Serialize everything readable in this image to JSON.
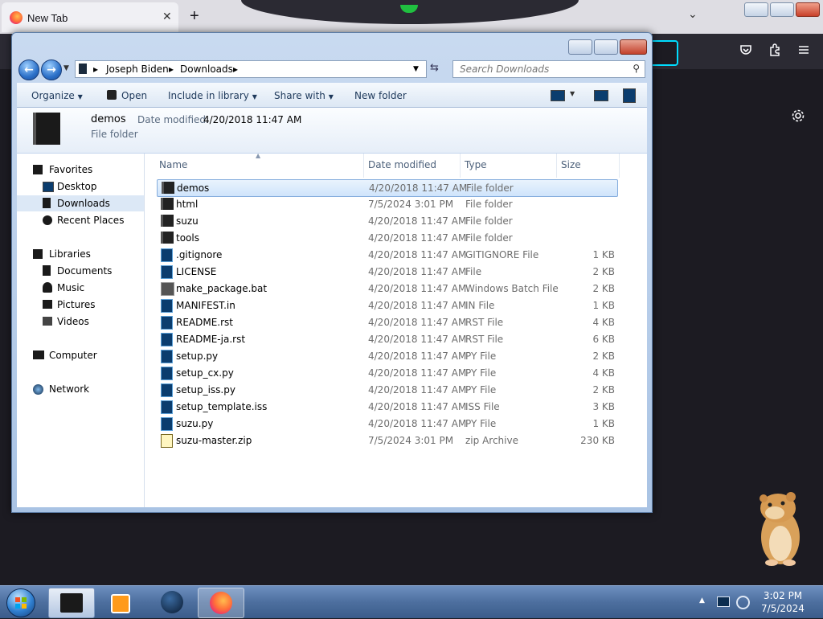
{
  "browser": {
    "tab_title": "New Tab",
    "tab_close": "✕",
    "new_tab": "+",
    "list_tabs": "⌄"
  },
  "explorer": {
    "breadcrumb": [
      "Joseph Biden",
      "Downloads"
    ],
    "search_placeholder": "Search Downloads",
    "commands": {
      "organize": "Organize",
      "open": "Open",
      "include_in_library": "Include in library",
      "share_with": "Share with",
      "new_folder": "New folder"
    },
    "details": {
      "name": "demos",
      "modified_label": "Date modified:",
      "modified_value": "4/20/2018 11:47 AM",
      "kind": "File folder"
    },
    "nav": {
      "favorites": "Favorites",
      "desktop": "Desktop",
      "downloads": "Downloads",
      "recent_places": "Recent Places",
      "libraries": "Libraries",
      "documents": "Documents",
      "music": "Music",
      "pictures": "Pictures",
      "videos": "Videos",
      "computer": "Computer",
      "network": "Network"
    },
    "columns": {
      "name": "Name",
      "date": "Date modified",
      "type": "Type",
      "size": "Size"
    },
    "files": [
      {
        "name": "demos",
        "date": "4/20/2018 11:47 AM",
        "type": "File folder",
        "size": "",
        "icon": "folder"
      },
      {
        "name": "html",
        "date": "7/5/2024 3:01 PM",
        "type": "File folder",
        "size": "",
        "icon": "folder"
      },
      {
        "name": "suzu",
        "date": "4/20/2018 11:47 AM",
        "type": "File folder",
        "size": "",
        "icon": "folder"
      },
      {
        "name": "tools",
        "date": "4/20/2018 11:47 AM",
        "type": "File folder",
        "size": "",
        "icon": "folder"
      },
      {
        "name": ".gitignore",
        "date": "4/20/2018 11:47 AM",
        "type": "GITIGNORE File",
        "size": "1 KB",
        "icon": "doc"
      },
      {
        "name": "LICENSE",
        "date": "4/20/2018 11:47 AM",
        "type": "File",
        "size": "2 KB",
        "icon": "doc"
      },
      {
        "name": "make_package.bat",
        "date": "4/20/2018 11:47 AM",
        "type": "Windows Batch File",
        "size": "2 KB",
        "icon": "bat"
      },
      {
        "name": "MANIFEST.in",
        "date": "4/20/2018 11:47 AM",
        "type": "IN File",
        "size": "1 KB",
        "icon": "doc"
      },
      {
        "name": "README.rst",
        "date": "4/20/2018 11:47 AM",
        "type": "RST File",
        "size": "4 KB",
        "icon": "doc"
      },
      {
        "name": "README-ja.rst",
        "date": "4/20/2018 11:47 AM",
        "type": "RST File",
        "size": "6 KB",
        "icon": "doc"
      },
      {
        "name": "setup.py",
        "date": "4/20/2018 11:47 AM",
        "type": "PY File",
        "size": "2 KB",
        "icon": "doc"
      },
      {
        "name": "setup_cx.py",
        "date": "4/20/2018 11:47 AM",
        "type": "PY File",
        "size": "4 KB",
        "icon": "doc"
      },
      {
        "name": "setup_iss.py",
        "date": "4/20/2018 11:47 AM",
        "type": "PY File",
        "size": "2 KB",
        "icon": "doc"
      },
      {
        "name": "setup_template.iss",
        "date": "4/20/2018 11:47 AM",
        "type": "ISS File",
        "size": "3 KB",
        "icon": "doc"
      },
      {
        "name": "suzu.py",
        "date": "4/20/2018 11:47 AM",
        "type": "PY File",
        "size": "1 KB",
        "icon": "doc"
      },
      {
        "name": "suzu-master.zip",
        "date": "7/5/2024 3:01 PM",
        "type": "zip Archive",
        "size": "230 KB",
        "icon": "zip"
      }
    ]
  },
  "taskbar": {
    "time": "3:02 PM",
    "date": "7/5/2024"
  },
  "colors": {
    "selection": "#cfe4fb",
    "focus_ring": "#00ddff"
  }
}
